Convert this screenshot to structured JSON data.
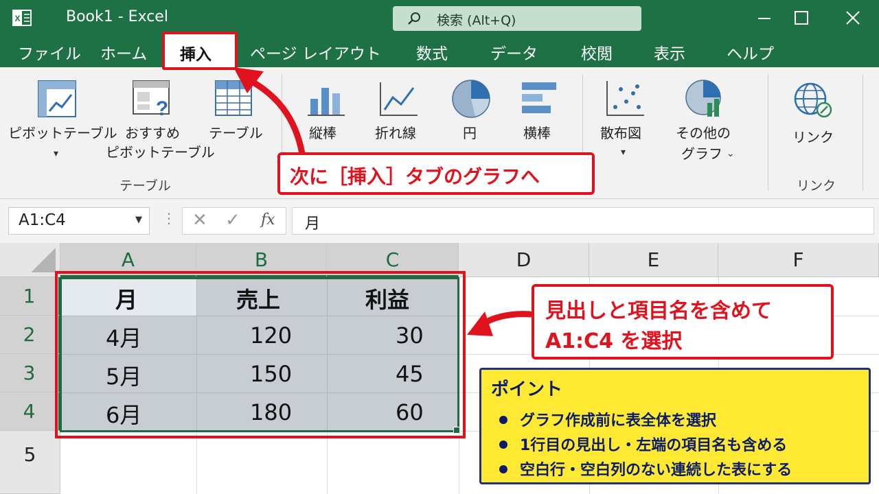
{
  "titlebar": {
    "title": "Book1  -  Excel",
    "search_text": "検索 (Alt+Q)"
  },
  "menu": {
    "items": [
      "ファイル",
      "ホーム",
      "挿入",
      "ページ レイアウト",
      "数式",
      "データ",
      "校閲",
      "表示",
      "ヘルプ"
    ],
    "active": "挿入"
  },
  "ribbon": {
    "pivot_table": "ピボットテーブル",
    "recommended_pivot_1": "おすすめ",
    "recommended_pivot_2": "ピボットテーブル",
    "table": "テーブル",
    "group_table": "テーブル",
    "column_chart": "縦棒",
    "line_chart": "折れ線",
    "pie_chart": "円",
    "bar_chart": "横棒",
    "scatter_chart": "散布図",
    "other_charts_1": "その他の",
    "other_charts_2": "グラフ",
    "link": "リンク",
    "group_link": "リンク"
  },
  "formula_bar": {
    "name_box": "A1:C4",
    "fx": "fx",
    "formula": "月"
  },
  "grid": {
    "columns": [
      "A",
      "B",
      "C",
      "D",
      "E",
      "F"
    ],
    "rows": [
      "1",
      "2",
      "3",
      "4",
      "5"
    ],
    "cells": {
      "A1": "月",
      "B1": "売上",
      "C1": "利益",
      "A2": "4月",
      "B2": "120",
      "C2": "30",
      "A3": "5月",
      "B3": "150",
      "C3": "45",
      "A4": "6月",
      "B4": "180",
      "C4": "60"
    }
  },
  "annotations": {
    "insert_callout": "次に［挿入］タブのグラフへ",
    "select_callout_1": "見出しと項目名を含めて",
    "select_callout_2": "A1:C4 を選択",
    "point_title": "ポイント",
    "point_items": [
      "グラフ作成前に表全体を選択",
      "1行目の見出し・左端の項目名も含める",
      "空白行・空白列のない連続した表にする"
    ]
  },
  "colors": {
    "excel_green": "#1e7145",
    "highlight_red": "#e0121e",
    "note_yellow": "#ffe933",
    "note_navy": "#0b1c6b"
  }
}
